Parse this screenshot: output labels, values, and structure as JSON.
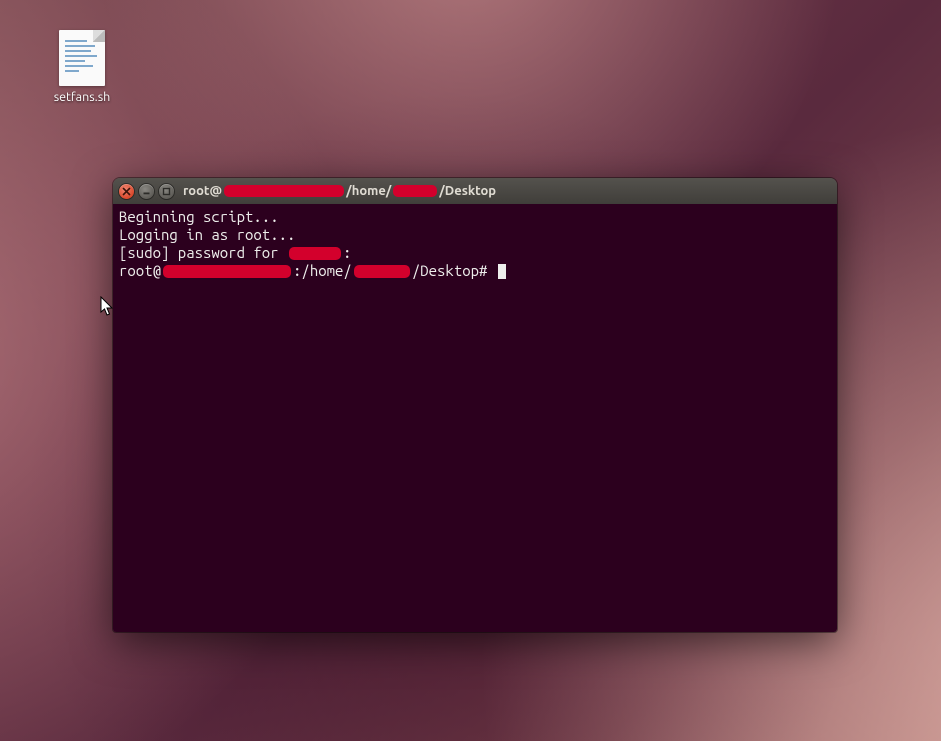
{
  "colors": {
    "redaction": "#d3002c",
    "terminal_bg": "#2c001e",
    "terminal_fg": "#eeeeec"
  },
  "desktop": {
    "file": {
      "name": "setfans.sh"
    }
  },
  "terminal": {
    "title": {
      "t1": "root@",
      "t2": "/home/",
      "t3": "/Desktop"
    },
    "lines": {
      "l1": "Beginning script...",
      "l2": "Logging in as root...",
      "l3a": "[sudo] password for ",
      "l3b": ":",
      "l4a": "root@",
      "l4b": ":/home/",
      "l4c": "/Desktop# "
    }
  },
  "redaction_widths": {
    "title_host": 120,
    "title_user": 44,
    "sudo_user": 52,
    "prompt_host": 128,
    "prompt_user": 56
  }
}
